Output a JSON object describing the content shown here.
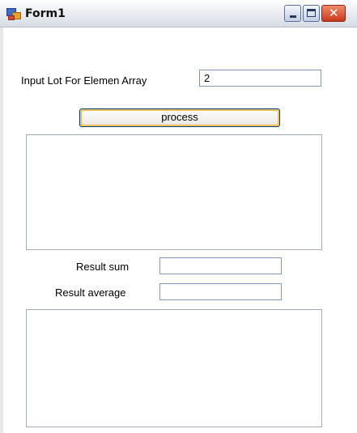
{
  "window": {
    "title": "Form1",
    "controls": {
      "minimize_icon": "minimize-icon",
      "maximize_icon": "maximize-icon",
      "close_icon": "close-icon"
    }
  },
  "form": {
    "input_label": "Input Lot For Elemen Array",
    "input_value": "2",
    "process_button": "process",
    "result_sum_label": "Result sum",
    "result_sum_value": "",
    "result_average_label": "Result average",
    "result_average_value": ""
  }
}
